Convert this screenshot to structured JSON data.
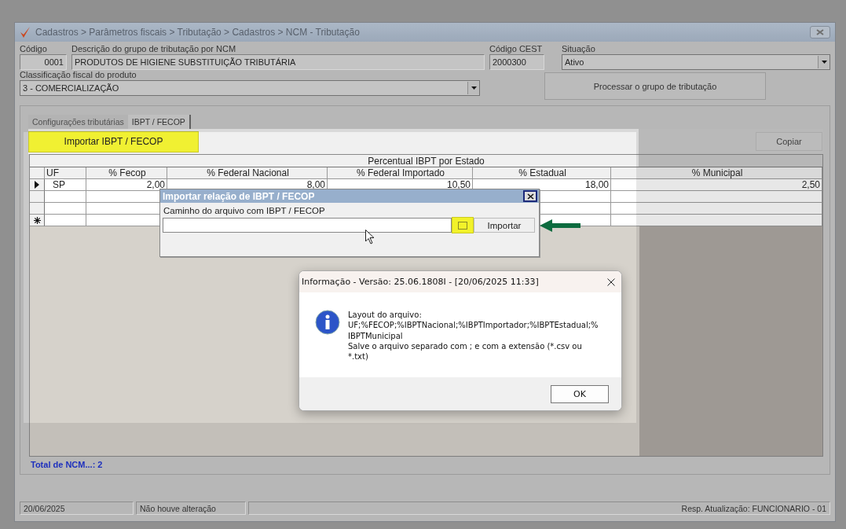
{
  "window": {
    "title": "Cadastros > Parâmetros fiscais > Tributação > Cadastros > NCM - Tributação"
  },
  "form": {
    "code": {
      "label": "Código",
      "value": "0001"
    },
    "description": {
      "label": "Descrição do grupo de tributação por NCM",
      "value": "PRODUTOS DE HIGIENE SUBSTITUIÇÃO TRIBUTÁRIA"
    },
    "cest": {
      "label": "Código CEST",
      "value": "2000300"
    },
    "status": {
      "label": "Situação",
      "value": "Ativo"
    },
    "classification": {
      "label": "Classificação fiscal do produto",
      "value": "3 - COMERCIALIZAÇÃO"
    },
    "process_button": "Processar o grupo de tributação"
  },
  "tabs": [
    {
      "label": "Configurações tributárias",
      "selected": false
    },
    {
      "label": "IBPT / FECOP",
      "selected": true
    }
  ],
  "toolbar": {
    "import_button": {
      "label": "Importar IBPT / FECOP",
      "highlighted": true
    },
    "copy_button": "Copiar"
  },
  "table": {
    "group_title": "Percentual IBPT por Estado",
    "columns": [
      "UF",
      "% Fecop",
      "% Federal Nacional",
      "% Federal Importado",
      "% Estadual",
      "% Municipal"
    ],
    "rows": [
      {
        "kind": "current",
        "cells": [
          "SP",
          "2,00",
          "8,00",
          "10,50",
          "18,00",
          "2,50"
        ]
      },
      {
        "kind": "empty"
      },
      {
        "kind": "empty"
      },
      {
        "kind": "new"
      }
    ]
  },
  "total": "Total de NCM...: 2",
  "status_bar": [
    "20/06/2025",
    "Não houve alteração",
    "Resp. Atualização: FUNCIONARIO - 01"
  ],
  "import_dialog": {
    "title": "Importar relação de IBPT / FECOP",
    "path_label": "Caminho do arquivo com IBPT / FECOP",
    "browse_highlighted": true,
    "import_button": "Importar"
  },
  "info_dialog": {
    "title": "Informação - Versão: 25.06.1808I - [20/06/2025 11:33]",
    "message": "Layout do arquivo:\nUF;%FECOP;%IBPTNacional;%IBPTImportador;%IBPTEstadual;%\nIBPTMunicipal\nSalve o arquivo separado com ; e com a extensão (*.csv ou\n*.txt)",
    "ok_button": "OK"
  }
}
